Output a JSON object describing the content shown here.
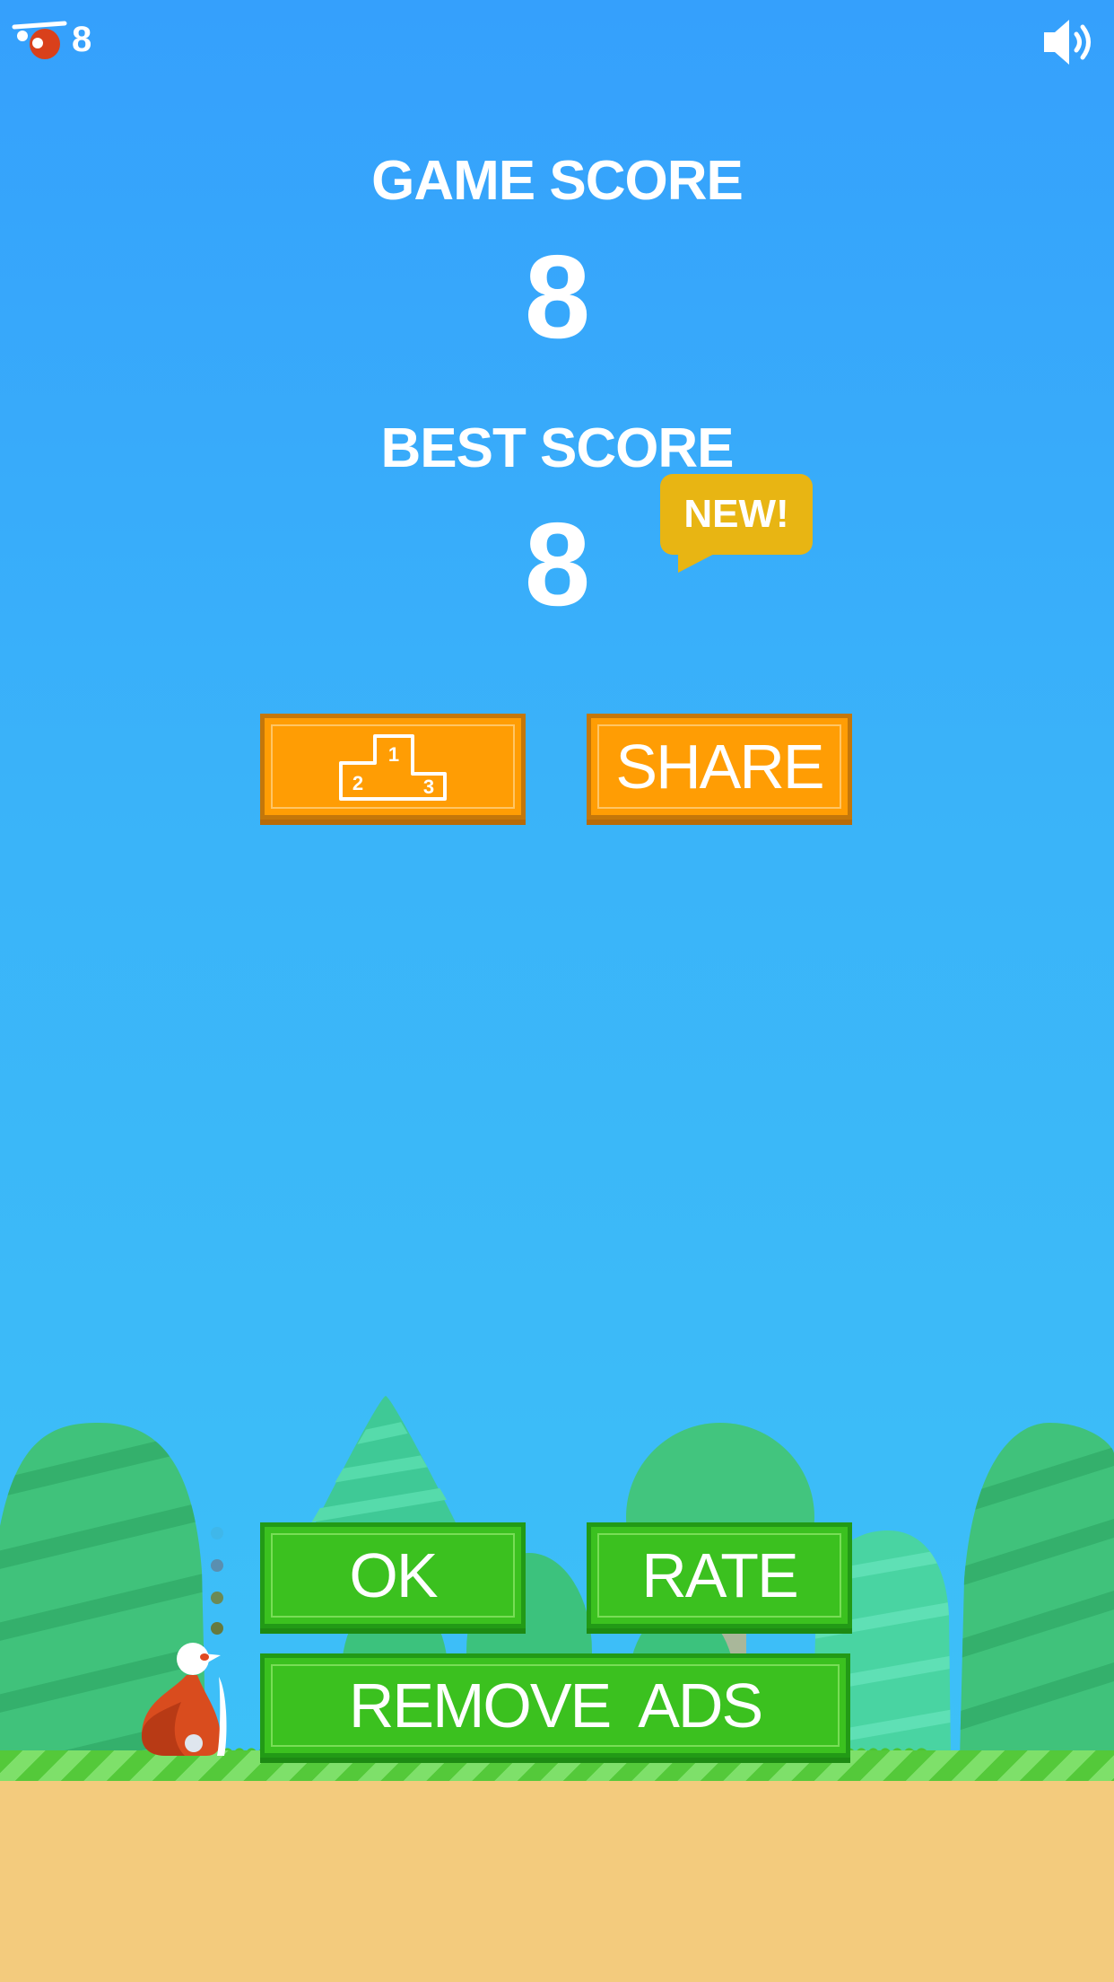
{
  "hud": {
    "coin_icon": "red-bird-coin-icon",
    "coin_count": "8",
    "sound_icon": "speaker-volume-icon"
  },
  "scores": {
    "game_score_label": "GAME SCORE",
    "game_score_value": "8",
    "best_score_label": "BEST SCORE",
    "best_score_value": "8",
    "new_badge": "NEW!"
  },
  "buttons": {
    "leaderboard_icon": "podium-leaderboard-icon",
    "podium_1": "1",
    "podium_2": "2",
    "podium_3": "3",
    "share_label": "SHARE",
    "ok_label": "OK",
    "rate_label": "RATE",
    "remove_ads_label": "REMOVE  ADS"
  },
  "colors": {
    "sky": "#35a0fc",
    "orange_button": "#ff9d04",
    "green_button": "#3bc11f",
    "badge": "#e8b513",
    "ground": "#f3cb7d",
    "grass": "#54c93a"
  }
}
